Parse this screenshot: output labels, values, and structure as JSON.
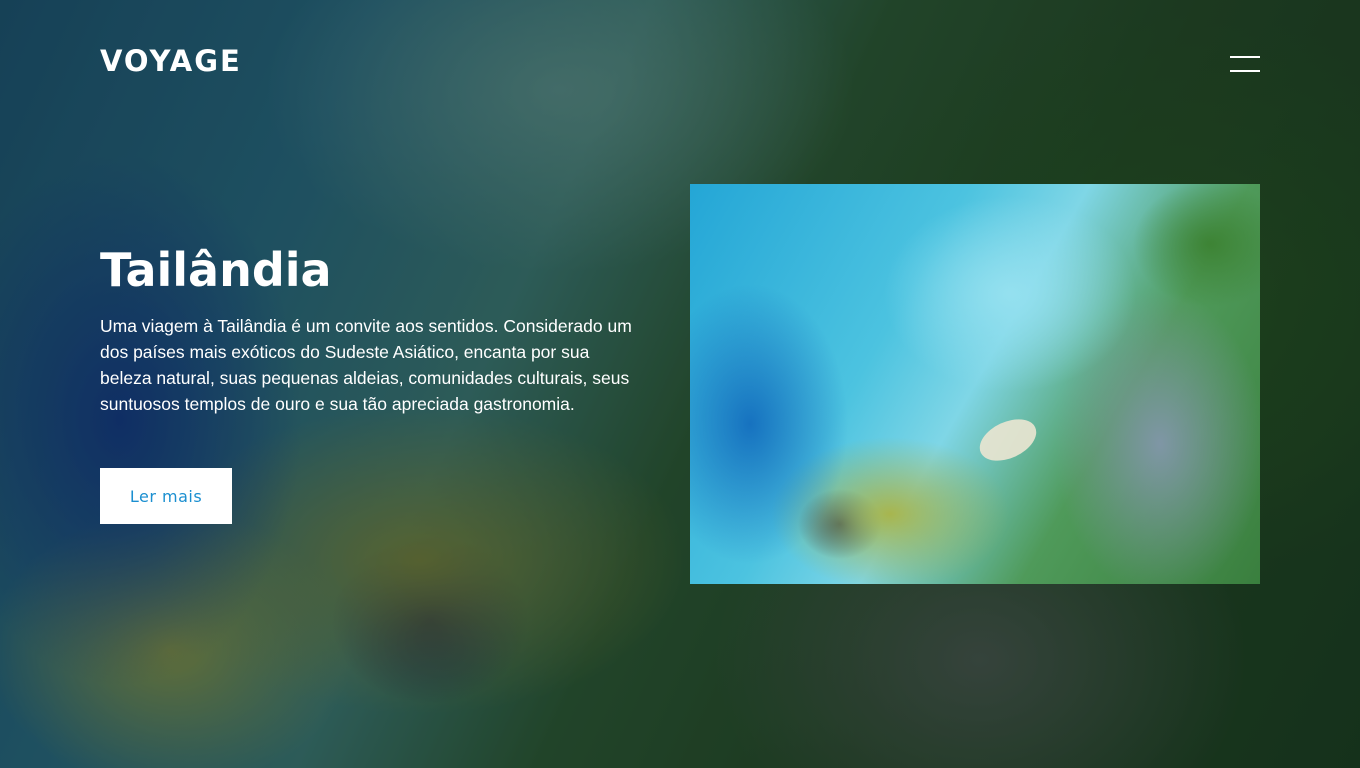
{
  "header": {
    "logo": "VOYAGE",
    "menu_icon": "hamburger-menu-icon"
  },
  "hero": {
    "title": "Tailândia",
    "description": "Uma viagem à Tailândia é um convite aos sentidos. Considerado um dos países mais exóticos do Sudeste Asiático, encanta por sua beleza natural, suas pequenas aldeias, comunidades culturais, seus suntuosos templos de ouro e sua tão apreciada gastronomia.",
    "cta_label": "Ler mais"
  },
  "colors": {
    "accent": "#1b8fd0",
    "text": "#ffffff",
    "button_bg": "#ffffff"
  }
}
